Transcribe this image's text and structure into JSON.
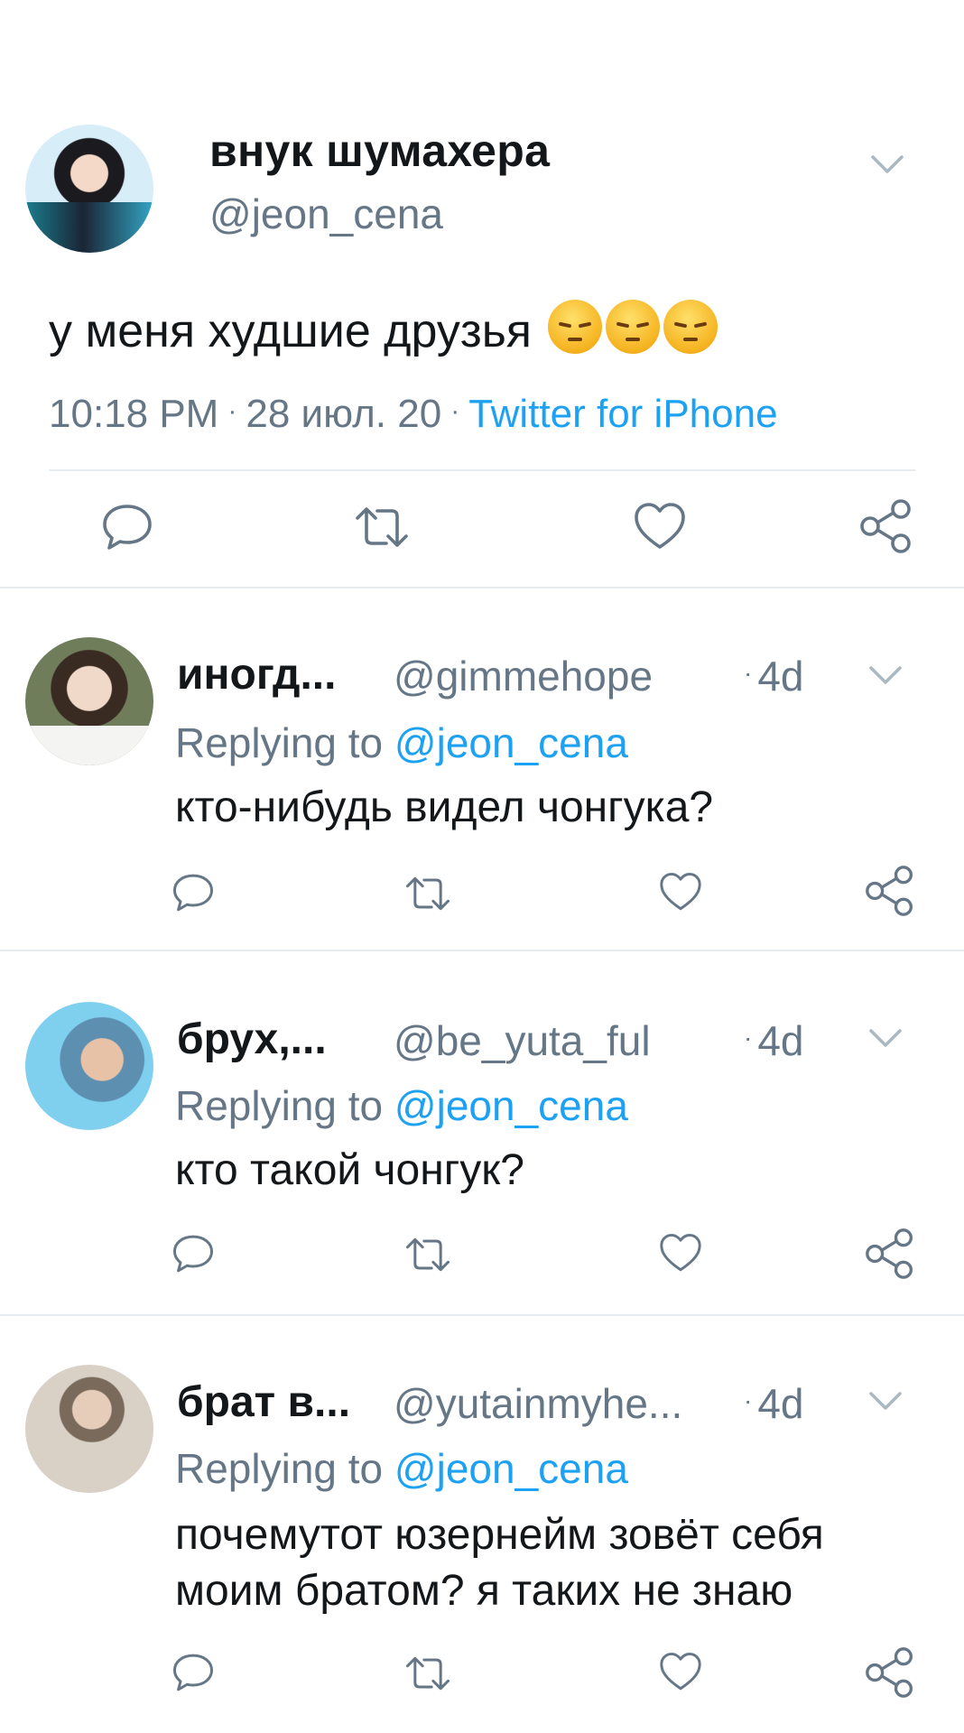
{
  "main_tweet": {
    "display_name": "внук шумахера",
    "handle": "@jeon_cena",
    "text": "у меня худшие друзья",
    "emojis": [
      "pensive-face",
      "pensive-face",
      "pensive-face"
    ],
    "time": "10:18 PM",
    "date": "28 июл. 20",
    "source": "Twitter for iPhone",
    "separator": "·"
  },
  "replies": [
    {
      "display_name": "иногд...",
      "handle": "@gimmehope",
      "time": "4d",
      "replying_prefix": "Replying to",
      "replying_to": "@jeon_cena",
      "text": "кто-нибудь видел чонгука?"
    },
    {
      "display_name": "брух,...",
      "handle": "@be_yuta_ful",
      "time": "4d",
      "replying_prefix": "Replying to",
      "replying_to": "@jeon_cena",
      "text": "кто такой чонгук?"
    },
    {
      "display_name": "брат в...",
      "handle": "@yutainmyhe...",
      "time": "4d",
      "replying_prefix": "Replying to",
      "replying_to": "@jeon_cena",
      "text": "почемутот юзернейм зовёт себя моим братом? я таких не знаю"
    }
  ],
  "actions": [
    "reply-icon",
    "retweet-icon",
    "like-icon",
    "share-icon"
  ],
  "colors": {
    "text": "#14171a",
    "secondary": "#657786",
    "accent": "#1da1f2",
    "divider": "#e6ecf0",
    "icon": "#657786"
  }
}
